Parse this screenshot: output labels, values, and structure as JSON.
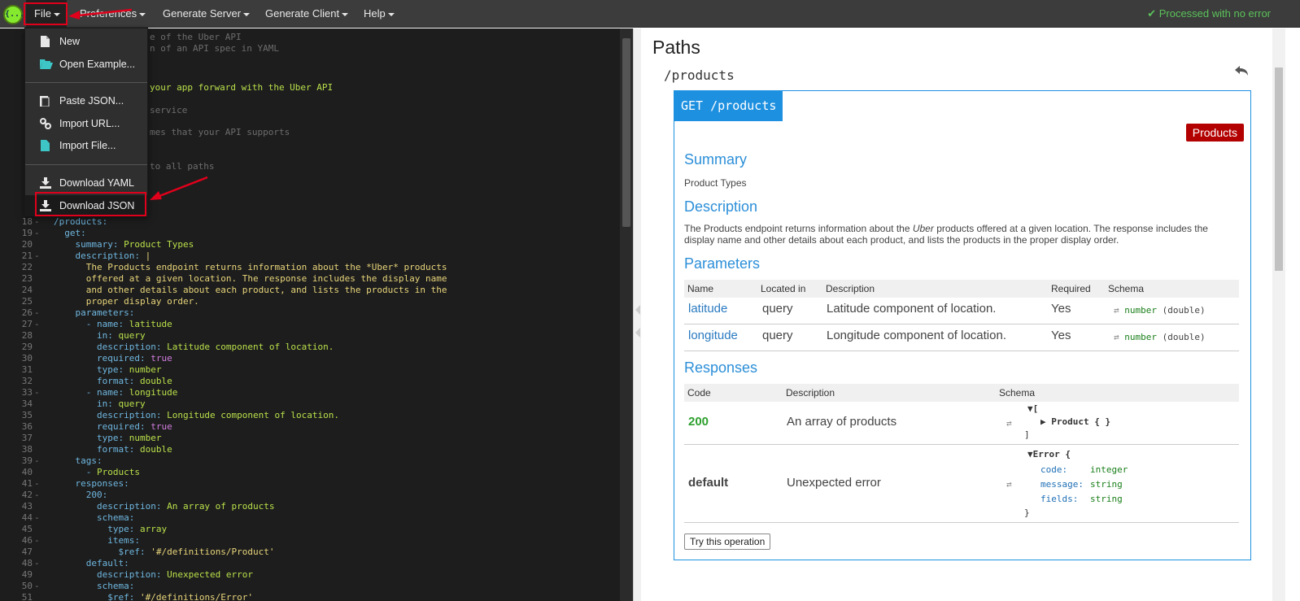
{
  "menu": {
    "file": "File",
    "preferences": "Preferences",
    "generate_server": "Generate Server",
    "generate_client": "Generate Client",
    "help": "Help",
    "status": "Processed with no error"
  },
  "file_menu": {
    "new": "New",
    "open_example": "Open Example...",
    "paste_json": "Paste JSON...",
    "import_url": "Import URL...",
    "import_file": "Import File...",
    "download_yaml": "Download YAML",
    "download_json": "Download JSON"
  },
  "editor": {
    "line_numbers": [
      "18",
      "19",
      "20",
      "21",
      "22",
      "23",
      "24",
      "25",
      "26",
      "27",
      "28",
      "29",
      "30",
      "31",
      "32",
      "33",
      "34",
      "35",
      "36",
      "37",
      "38",
      "39",
      "40",
      "41",
      "42",
      "43",
      "44",
      "45",
      "46",
      "47",
      "48",
      "49",
      "50",
      "51"
    ],
    "partial_lines": [
      "e of the Uber API",
      "n of an API spec in YAML",
      "your app forward with the Uber API",
      "service",
      "mes that your API supports",
      "to all paths"
    ],
    "partial_numbers": [
      "1",
      "1",
      "1",
      "1",
      "1",
      "1",
      "1"
    ]
  },
  "preview": {
    "paths_title": "Paths",
    "path": "/products",
    "op_head": "GET /products",
    "tag": "Products",
    "summary_h": "Summary",
    "summary": "Product Types",
    "description_h": "Description",
    "description_1": "The Products endpoint returns information about the ",
    "description_em": "Uber",
    "description_2": " products offered at a given location. The response includes the display name and other details about each product, and lists the products in the proper display order.",
    "parameters_h": "Parameters",
    "param_cols": [
      "Name",
      "Located in",
      "Description",
      "Required",
      "Schema"
    ],
    "params": [
      {
        "name": "latitude",
        "in": "query",
        "description": "Latitude component of location.",
        "required": "Yes",
        "type": "number",
        "format": "(double)"
      },
      {
        "name": "longitude",
        "in": "query",
        "description": "Longitude component of location.",
        "required": "Yes",
        "type": "number",
        "format": "(double)"
      }
    ],
    "responses_h": "Responses",
    "resp_cols": [
      "Code",
      "Description",
      "Schema"
    ],
    "resp_200": {
      "code": "200",
      "description": "An array of products",
      "open": "[",
      "model": "Product { }",
      "close": "]"
    },
    "resp_default": {
      "code": "default",
      "description": "Unexpected error",
      "model": "Error {",
      "f1": "code:",
      "t1": "integer",
      "f2": "message:",
      "t2": "string",
      "f3": "fields:",
      "t3": "string",
      "close": "}"
    },
    "try": "Try this operation"
  }
}
